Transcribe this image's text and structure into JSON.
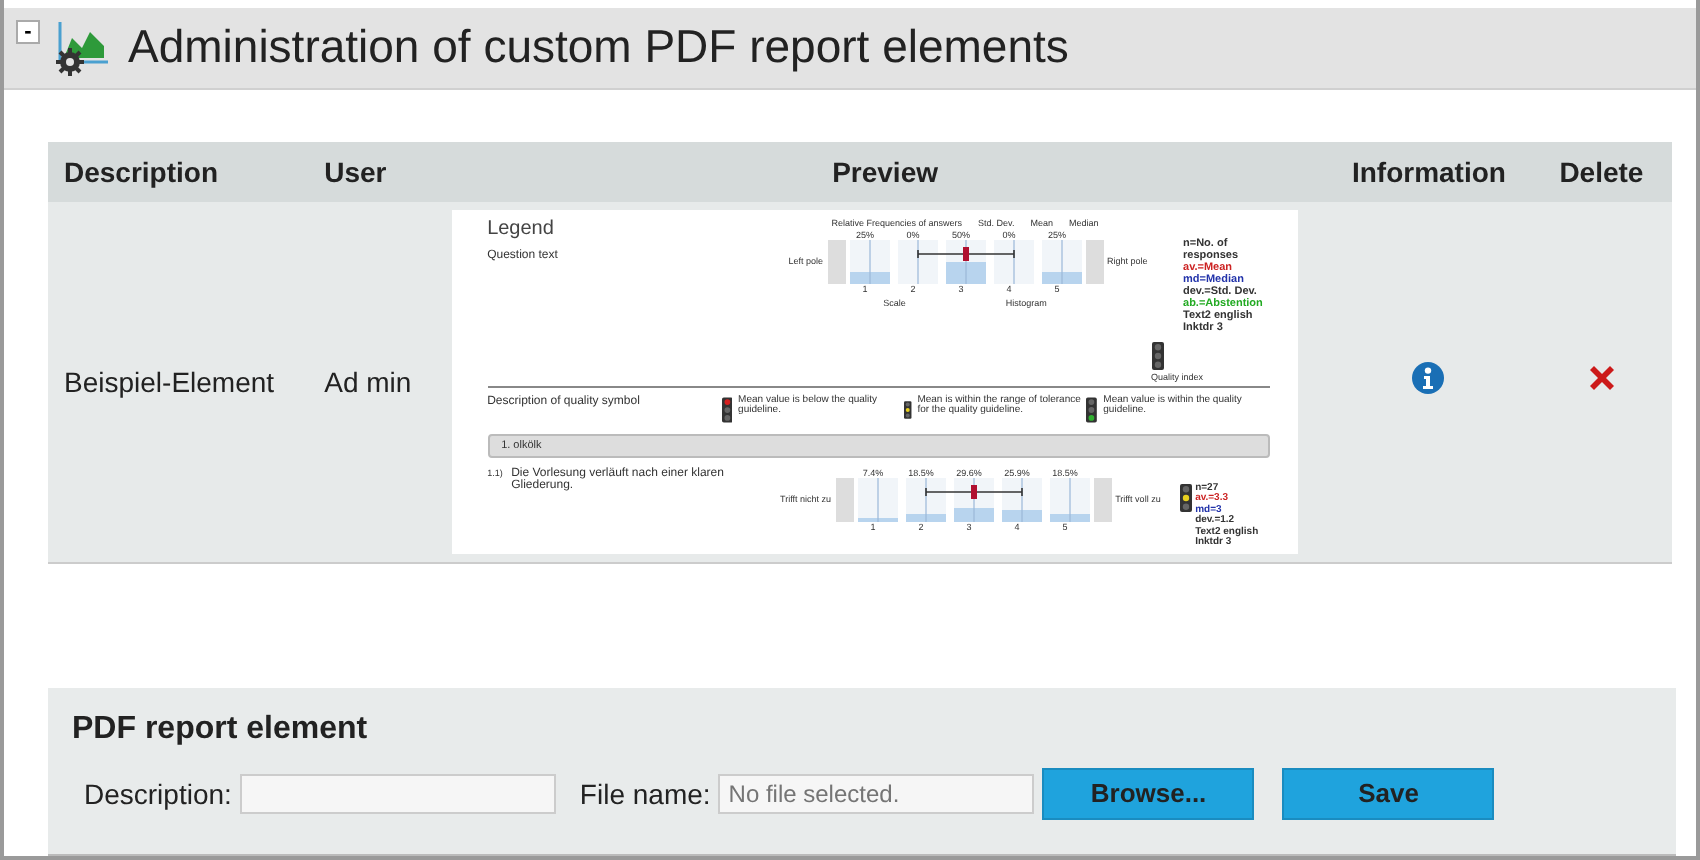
{
  "header": {
    "collapse": "-",
    "title": "Administration of custom PDF report elements"
  },
  "table": {
    "columns": [
      "Description",
      "User",
      "Preview",
      "Information",
      "Delete"
    ],
    "rows": [
      {
        "description": "Beispiel-Element",
        "user": "Ad min",
        "preview": {
          "legend": "Legend",
          "question": "Question text",
          "chart_top": [
            "Relative Frequencies of answers",
            "Std. Dev.",
            "Mean",
            "Median"
          ],
          "bars": [
            {
              "label": "25%",
              "level": 0.25
            },
            {
              "label": "0%",
              "level": 0
            },
            {
              "label": "50%",
              "level": 0.5
            },
            {
              "label": "0%",
              "level": 0
            },
            {
              "label": "25%",
              "level": 0.25
            }
          ],
          "scale": [
            "1",
            "2",
            "3",
            "4",
            "5"
          ],
          "left_pole": "Left pole",
          "right_pole": "Right pole",
          "scale_label": "Scale",
          "histogram_label": "Histogram",
          "stats": [
            {
              "text": "n=No. of responses",
              "color": "#333333"
            },
            {
              "text": "av.=Mean",
              "color": "#cc2222"
            },
            {
              "text": "md=Median",
              "color": "#2233aa"
            },
            {
              "text": "dev.=Std. Dev.",
              "color": "#333333"
            },
            {
              "text": "ab.=Abstention",
              "color": "#22aa22"
            },
            {
              "text": "Text2 english",
              "color": "#333333"
            },
            {
              "text": "Inktdr 3",
              "color": "#333333"
            }
          ],
          "quality_label": "Quality index",
          "symbol_heading": "Description of quality symbol",
          "symbols": [
            {
              "kind": "red",
              "text": "Mean value is below the quality guideline."
            },
            {
              "kind": "yellow",
              "text": "Mean is within the range of tolerance for the quality guideline."
            },
            {
              "kind": "green",
              "text": "Mean value is within the quality guideline."
            }
          ],
          "section": "1. olkölk",
          "item": {
            "number": "1.1)",
            "text": "Die Vorlesung verläuft nach einer klaren Gliederung.",
            "left_pole": "Trifft nicht zu",
            "right_pole": "Trifft voll zu",
            "bars": [
              {
                "label": "7.4%",
                "level": 0.074
              },
              {
                "label": "18.5%",
                "level": 0.185
              },
              {
                "label": "29.6%",
                "level": 0.296
              },
              {
                "label": "25.9%",
                "level": 0.259
              },
              {
                "label": "18.5%",
                "level": 0.185
              }
            ],
            "scale": [
              "1",
              "2",
              "3",
              "4",
              "5"
            ],
            "quality_light": {
              "kind": "yellow"
            },
            "stats": [
              {
                "text": "n=27",
                "color": "#333333"
              },
              {
                "text": "av.=3.3",
                "color": "#cc2222"
              },
              {
                "text": "md=3",
                "color": "#2233aa"
              },
              {
                "text": "dev.=1.2",
                "color": "#333333"
              },
              {
                "text": "Text2 english",
                "color": "#333333"
              },
              {
                "text": "Inktdr 3",
                "color": "#333333"
              }
            ]
          }
        }
      }
    ]
  },
  "form": {
    "title": "PDF report element",
    "description_label": "Description:",
    "file_label": "File name:",
    "file_placeholder": "No file selected.",
    "browse": "Browse...",
    "save": "Save"
  }
}
